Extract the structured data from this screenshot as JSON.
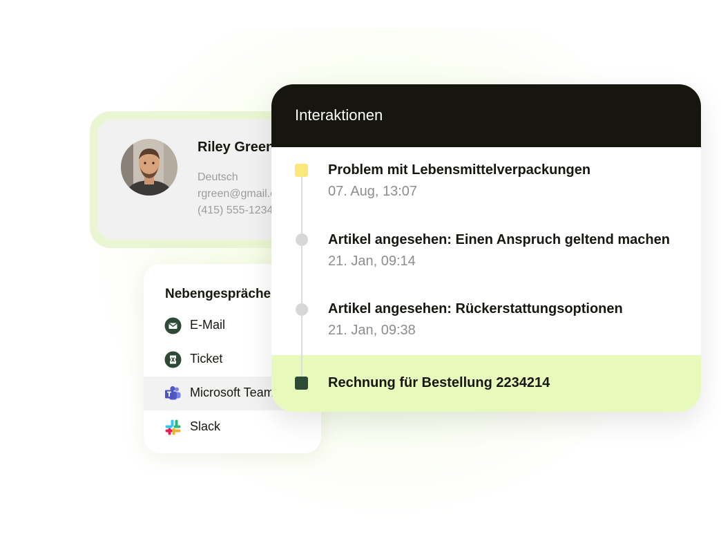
{
  "profile": {
    "name": "Riley Green",
    "language": "Deutsch",
    "email": "rgreen@gmail.com",
    "phone": "(415) 555-1234"
  },
  "side_conversations": {
    "title": "Nebengespräche",
    "items": [
      {
        "label": "E-Mail",
        "icon": "mail-icon"
      },
      {
        "label": "Ticket",
        "icon": "ticket-icon"
      },
      {
        "label": "Microsoft Teams",
        "icon": "microsoft-teams-icon"
      },
      {
        "label": "Slack",
        "icon": "slack-icon"
      }
    ]
  },
  "interactions": {
    "title": "Interaktionen",
    "items": [
      {
        "title": "Problem mit Lebensmittelverpackungen",
        "date": "07. Aug, 13:07",
        "marker": "yellow-square"
      },
      {
        "title": "Artikel angesehen: Einen Anspruch geltend machen",
        "date": "21. Jan, 09:14",
        "marker": "gray-dot"
      },
      {
        "title": "Artikel angesehen: Rückerstattungsoptionen",
        "date": "21. Jan, 09:38",
        "marker": "gray-dot"
      },
      {
        "title": "Rechnung für Bestellung 2234214",
        "marker": "green-square"
      }
    ]
  },
  "colors": {
    "panel_header": "#16160f",
    "highlight_row": "#e8f9bc",
    "yellow_marker": "#fbe77a",
    "green_marker": "#2d4a37",
    "accent_glow": "#eaf6d3"
  }
}
